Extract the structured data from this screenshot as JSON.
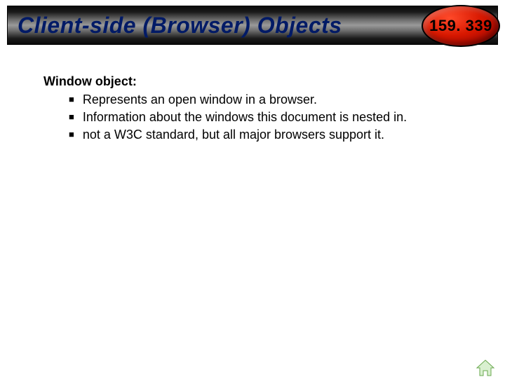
{
  "header": {
    "title": "Client-side (Browser) Objects",
    "badge": "159. 339"
  },
  "content": {
    "heading": "Window object:",
    "bullets": [
      "Represents an open window in a browser.",
      "Information about the windows this document is nested in.",
      "not a W3C standard, but all major browsers support it."
    ]
  }
}
